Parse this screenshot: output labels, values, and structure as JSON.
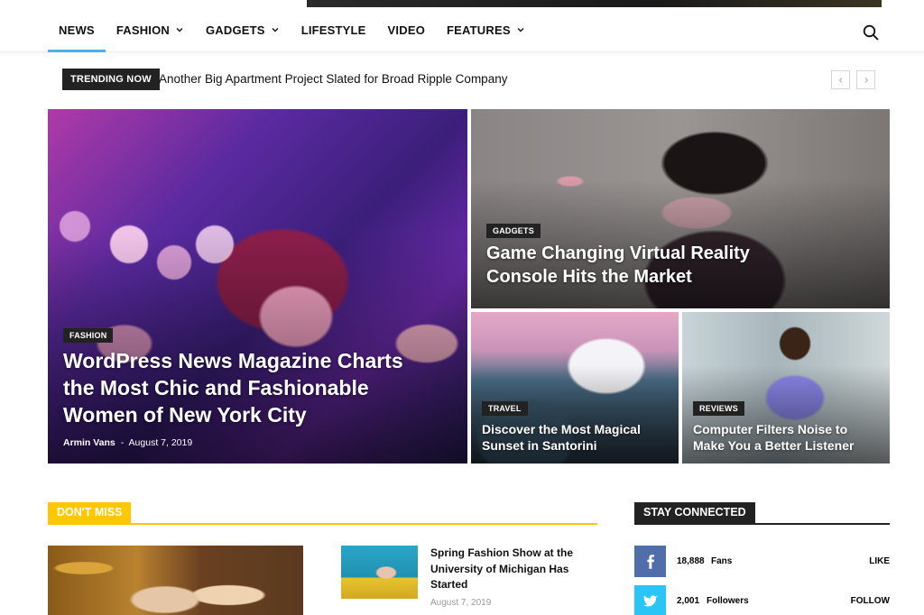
{
  "nav": {
    "items": [
      {
        "label": "NEWS",
        "active": true,
        "dropdown": false
      },
      {
        "label": "FASHION",
        "active": false,
        "dropdown": true
      },
      {
        "label": "GADGETS",
        "active": false,
        "dropdown": true
      },
      {
        "label": "LIFESTYLE",
        "active": false,
        "dropdown": false
      },
      {
        "label": "VIDEO",
        "active": false,
        "dropdown": false
      },
      {
        "label": "FEATURES",
        "active": false,
        "dropdown": true
      }
    ],
    "search_icon": "search-icon",
    "accent_color": "#4db2ec"
  },
  "trending": {
    "label": "TRENDING NOW",
    "headline": "Another Big Apartment Project Slated for Broad Ripple Company",
    "prev_icon": "chevron-left-icon",
    "next_icon": "chevron-right-icon"
  },
  "hero": {
    "main": {
      "category": "FASHION",
      "title": "WordPress News Magazine Charts the Most Chic and Fashionable Women of New York City",
      "author": "Armin Vans",
      "separator": "-",
      "date": "August 7, 2019"
    },
    "top_right": {
      "category": "GADGETS",
      "title": "Game Changing Virtual Reality Console Hits the Market"
    },
    "bottom_left": {
      "category": "TRAVEL",
      "title": "Discover the Most Magical Sunset in Santorini"
    },
    "bottom_right": {
      "category": "REVIEWS",
      "title": "Computer Filters Noise to Make You a Better Listener"
    }
  },
  "dont_miss": {
    "label": "DON'T MISS",
    "accent_color": "#ffc700",
    "article": {
      "title": "Spring Fashion Show at the University of Michigan Has Started",
      "date": "August 7, 2019"
    }
  },
  "stay_connected": {
    "label": "STAY CONNECTED",
    "facebook": {
      "icon": "facebook-icon",
      "count": "18,888",
      "unit": "Fans",
      "action": "LIKE",
      "color": "#516eab"
    },
    "twitter": {
      "icon": "twitter-icon",
      "count": "2,001",
      "unit": "Followers",
      "action": "FOLLOW",
      "color": "#29c5f6"
    }
  }
}
